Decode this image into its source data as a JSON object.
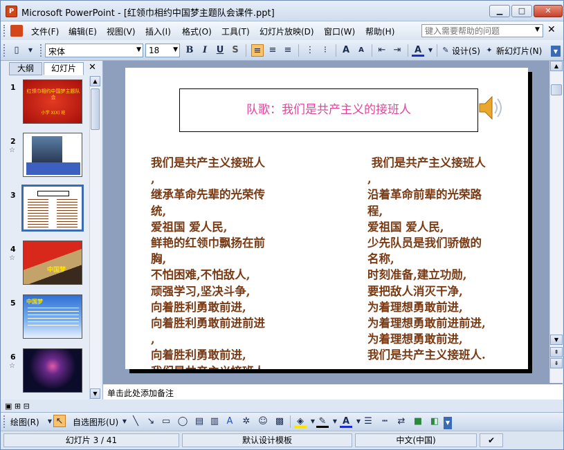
{
  "window": {
    "title": "Microsoft PowerPoint - [红领巾相约中国梦主题队会课件.ppt]",
    "app_icon": "powerpoint-icon",
    "min_label": "▭",
    "max_label": "□",
    "close_label": "✕"
  },
  "menu": {
    "items": [
      "文件(F)",
      "编辑(E)",
      "视图(V)",
      "插入(I)",
      "格式(O)",
      "工具(T)",
      "幻灯片放映(D)",
      "窗口(W)",
      "帮助(H)"
    ],
    "help_placeholder": "键入需要帮助的问题"
  },
  "toolbar": {
    "font_name": "宋体",
    "font_size": "18",
    "bold": "B",
    "italic": "I",
    "underline": "U",
    "shadow": "S",
    "design_label": "设计(S)",
    "new_slide_label": "新幻灯片(N)"
  },
  "left_panel": {
    "tabs": [
      "大纲",
      "幻灯片"
    ],
    "selected_tab": "幻灯片",
    "slide_numbers": [
      "1",
      "2",
      "3",
      "4",
      "5",
      "6"
    ],
    "thumb1_title": "红领巾相约中国梦主题队会",
    "thumb1_sub": "小学 X(X) 班",
    "thumb3_header": "队歌：我们是共产主义的接班人",
    "thumb4_text": "中国梦",
    "thumb5_title": "中国梦"
  },
  "slide": {
    "title": "队歌：我们是共产主义的接班人",
    "left_column": [
      "我们是共产主义接班人",
      ",",
      "继承革命先辈的光荣传",
      "统,",
      "爱祖国 爱人民,",
      "鲜艳的红领巾飘扬在前",
      "胸,",
      "不怕困难,不怕敌人,",
      "顽强学习,坚决斗争,",
      "向着胜利勇敢前进,",
      "向着胜利勇敢前进前进",
      ",",
      "向着胜利勇敢前进,",
      "我们是共产主义接班人"
    ],
    "right_column": [
      " 我们是共产主义接班人",
      ",",
      "沿着革命前辈的光荣路",
      "程,",
      "爱祖国 爱人民,",
      "少先队员是我们骄傲的",
      "名称,",
      "时刻准备,建立功勋,",
      "要把敌人消灭干净,",
      "为着理想勇敢前进,",
      "为着理想勇敢前进前进,",
      "为着理想勇敢前进,",
      "我们是共产主义接班人."
    ]
  },
  "notes": {
    "placeholder": "单击此处添加备注"
  },
  "draw_toolbar": {
    "draw_label": "绘图(R)",
    "autoshape_label": "自选图形(U)"
  },
  "status": {
    "slide_info": "幻灯片 3 / 41",
    "template": "默认设计模板",
    "language": "中文(中国)"
  },
  "colors": {
    "slide_title": "#e0459e",
    "lyrics": "#7a3a14",
    "accent_selected": "#3b6bb3"
  }
}
